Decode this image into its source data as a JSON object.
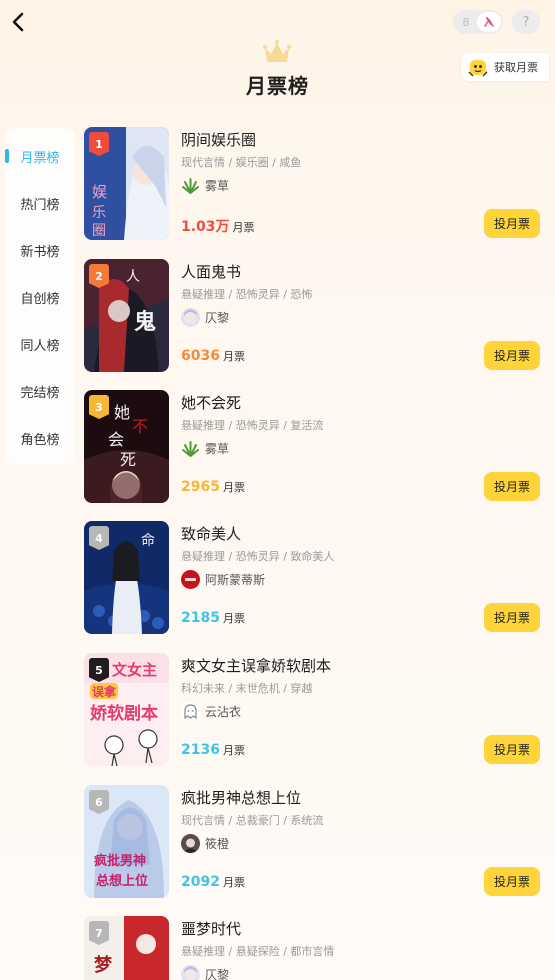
{
  "header": {
    "title": "月票榜",
    "get_ticket_label": "获取月票",
    "help_label": "?",
    "toggle_left": "8"
  },
  "sidebar": {
    "active_index": 0,
    "items": [
      {
        "label": "月票榜"
      },
      {
        "label": "热门榜"
      },
      {
        "label": "新书榜"
      },
      {
        "label": "自创榜"
      },
      {
        "label": "同人榜"
      },
      {
        "label": "完结榜"
      },
      {
        "label": "角色榜"
      }
    ]
  },
  "vote_label": "投月票",
  "vote_unit": "月票",
  "colors": {
    "accent": "#2ab9e8",
    "vote_button": "#ffd43b",
    "rank1": "#f04b3b",
    "rank2": "#f57a3a",
    "rank3": "#f7b733",
    "rank_other": "#b7b7b7",
    "votes_1": "#f04b3b",
    "votes_2": "#f58a3a",
    "votes_3": "#f7b733",
    "votes_other": "#3fc4e6"
  },
  "books": [
    {
      "rank": "1",
      "title": "阴间娱乐圈",
      "tags": "现代言情 / 娱乐圈 / 咸鱼",
      "author": "雾草",
      "votes": "1.03万",
      "cover_text": "娱乐圈"
    },
    {
      "rank": "2",
      "title": "人面鬼书",
      "tags": "悬疑推理 / 恐怖灵异 / 恐怖",
      "author": "仄黎",
      "votes": "6036",
      "cover_text": "人面鬼"
    },
    {
      "rank": "3",
      "title": "她不会死",
      "tags": "悬疑推理 / 恐怖灵异 / 复活流",
      "author": "雾草",
      "votes": "2965",
      "cover_text": "她不会死"
    },
    {
      "rank": "4",
      "title": "致命美人",
      "tags": "悬疑推理 / 恐怖灵异 / 致命美人",
      "author": "阿斯蒙蒂斯",
      "votes": "2185",
      "cover_text": "致命美人"
    },
    {
      "rank": "5",
      "title": "爽文女主误拿娇软剧本",
      "tags": "科幻未来 / 末世危机 / 穿越",
      "author": "云沾衣",
      "votes": "2136",
      "cover_text": "娇软剧本"
    },
    {
      "rank": "6",
      "title": "疯批男神总想上位",
      "tags": "现代言情 / 总裁豪门 / 系统流",
      "author": "筱橙",
      "votes": "2092",
      "cover_text": "疯批男神总想上位"
    },
    {
      "rank": "7",
      "title": "噩梦时代",
      "tags": "悬疑推理 / 悬疑探险 / 都市言情",
      "author": "仄黎",
      "votes": "",
      "cover_text": "梦"
    }
  ]
}
